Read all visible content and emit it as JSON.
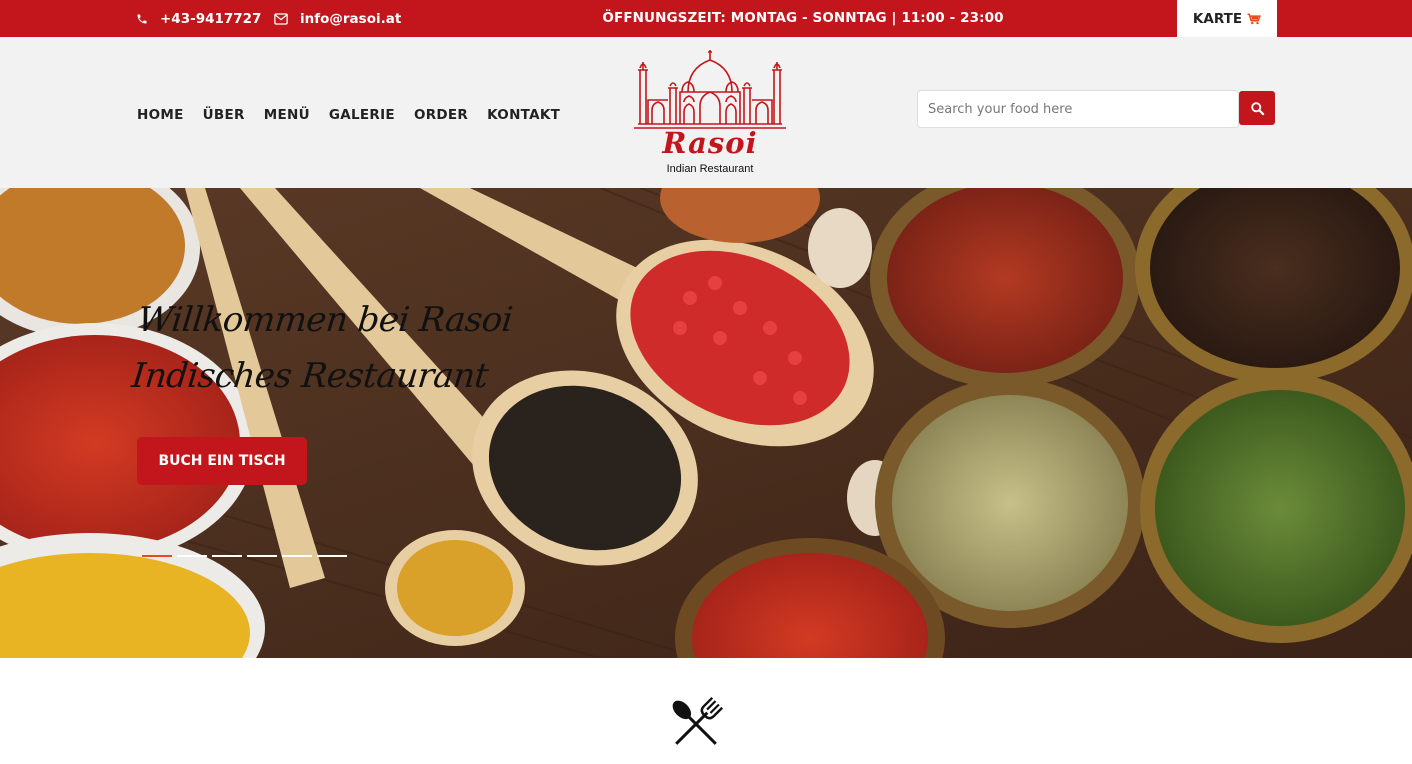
{
  "topbar": {
    "phone": "+43-9417727",
    "email": "info@rasoi.at",
    "hours": "ÖFFNUNGSZEIT: MONTAG - SONNTAG | 11:00 - 23:00",
    "cart_label": "KARTE",
    "icons": {
      "phone": "phone-icon",
      "email": "envelope-icon",
      "cart": "cart-icon"
    }
  },
  "nav": {
    "items": [
      {
        "label": "HOME"
      },
      {
        "label": "ÜBER"
      },
      {
        "label": "MENÜ"
      },
      {
        "label": "GALERIE"
      },
      {
        "label": "ORDER"
      },
      {
        "label": "KONTAKT"
      }
    ]
  },
  "logo": {
    "brand": "Rasoi",
    "tagline": "Indian Restaurant"
  },
  "search": {
    "placeholder": "Search your food here",
    "value": ""
  },
  "hero": {
    "title": "Willkommen bei Rasoi Indisches Restaurant",
    "button_label": "BUCH EIN TISCH",
    "slides": 6,
    "active_slide": 1
  },
  "colors": {
    "brand_red": "#c3161c",
    "active_dot": "#e84a1d",
    "header_bg": "#f2f2f2"
  }
}
